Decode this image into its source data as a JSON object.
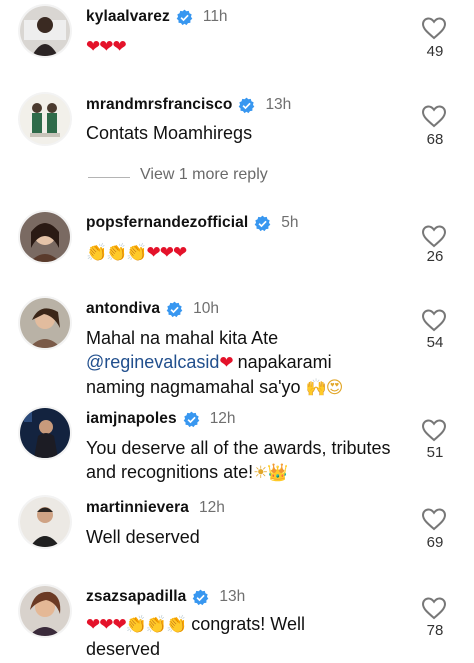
{
  "comments": [
    {
      "username": "kylaalvarez",
      "verified": true,
      "time": "11h",
      "text": "",
      "emoji": "❤❤❤",
      "likes": "49"
    },
    {
      "username": "mrandmrsfrancisco",
      "verified": true,
      "time": "13h",
      "text": "Contats Moamhiregs",
      "likes": "68"
    },
    {
      "username": "popsfernandezofficial",
      "verified": true,
      "time": "5h",
      "text": "",
      "emoji_claps": "👏👏👏",
      "emoji_hearts": "❤❤❤",
      "likes": "26"
    },
    {
      "username": "antondiva",
      "verified": true,
      "time": "10h",
      "text_1": "Mahal na mahal kita Ate",
      "mention": "@reginevalcasid",
      "text_2": " napakarami",
      "text_3": "naming nagmamahal sa'yo ",
      "emoji_end": "🙌😍",
      "heart": "❤",
      "likes": "54"
    },
    {
      "username": "iamjnapoles",
      "verified": true,
      "time": "12h",
      "text_1": "You deserve all of the awards, tributes",
      "text_2": "and recognitions ate!",
      "emoji_end": "☀👑",
      "likes": "51"
    },
    {
      "username": "martinnievera",
      "verified": false,
      "time": "12h",
      "text": "Well deserved",
      "likes": "69"
    },
    {
      "username": "zsazsapadilla",
      "verified": true,
      "time": "13h",
      "emoji_hearts": "❤❤❤",
      "emoji_claps": "👏👏👏",
      "text_1": " congrats! Well",
      "text_2": "deserved",
      "likes": "78"
    }
  ],
  "view_more": "View 1 more reply",
  "icons": {
    "like": "heart-outline-icon",
    "verified": "verified-badge-icon"
  },
  "colors": {
    "verified": "#3897f0",
    "mention": "#214f8d",
    "heart": "#e4122a",
    "muted": "#6f6f6f"
  }
}
